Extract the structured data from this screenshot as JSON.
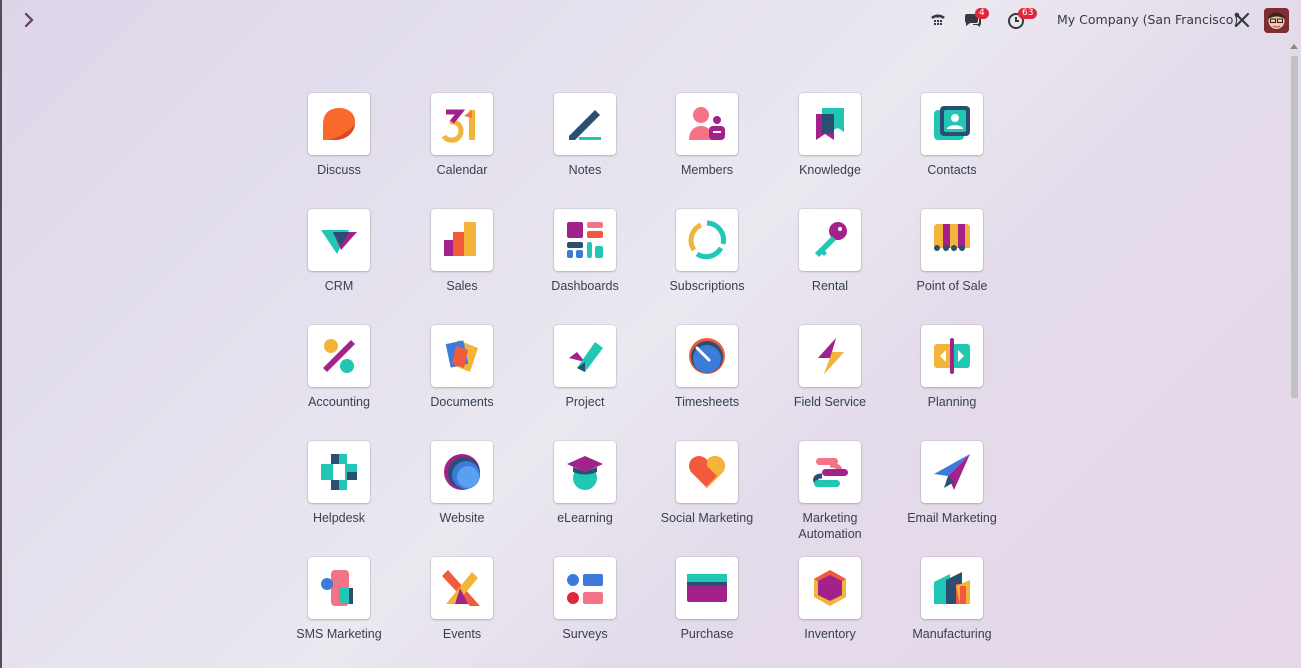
{
  "topbar": {
    "company": "My Company (San Francisco)",
    "messages_badge": "4",
    "activities_badge": "63"
  },
  "apps": [
    {
      "label": "Discuss"
    },
    {
      "label": "Calendar",
      "glyph": "31"
    },
    {
      "label": "Notes"
    },
    {
      "label": "Members"
    },
    {
      "label": "Knowledge"
    },
    {
      "label": "Contacts"
    },
    {
      "label": "CRM"
    },
    {
      "label": "Sales"
    },
    {
      "label": "Dashboards"
    },
    {
      "label": "Subscriptions"
    },
    {
      "label": "Rental"
    },
    {
      "label": "Point of Sale"
    },
    {
      "label": "Accounting"
    },
    {
      "label": "Documents"
    },
    {
      "label": "Project"
    },
    {
      "label": "Timesheets"
    },
    {
      "label": "Field Service"
    },
    {
      "label": "Planning"
    },
    {
      "label": "Helpdesk"
    },
    {
      "label": "Website"
    },
    {
      "label": "eLearning"
    },
    {
      "label": "Social Marketing"
    },
    {
      "label": "Marketing Automation"
    },
    {
      "label": "Email Marketing"
    },
    {
      "label": "SMS Marketing"
    },
    {
      "label": "Events"
    },
    {
      "label": "Surveys"
    },
    {
      "label": "Purchase"
    },
    {
      "label": "Inventory"
    },
    {
      "label": "Manufacturing"
    }
  ]
}
